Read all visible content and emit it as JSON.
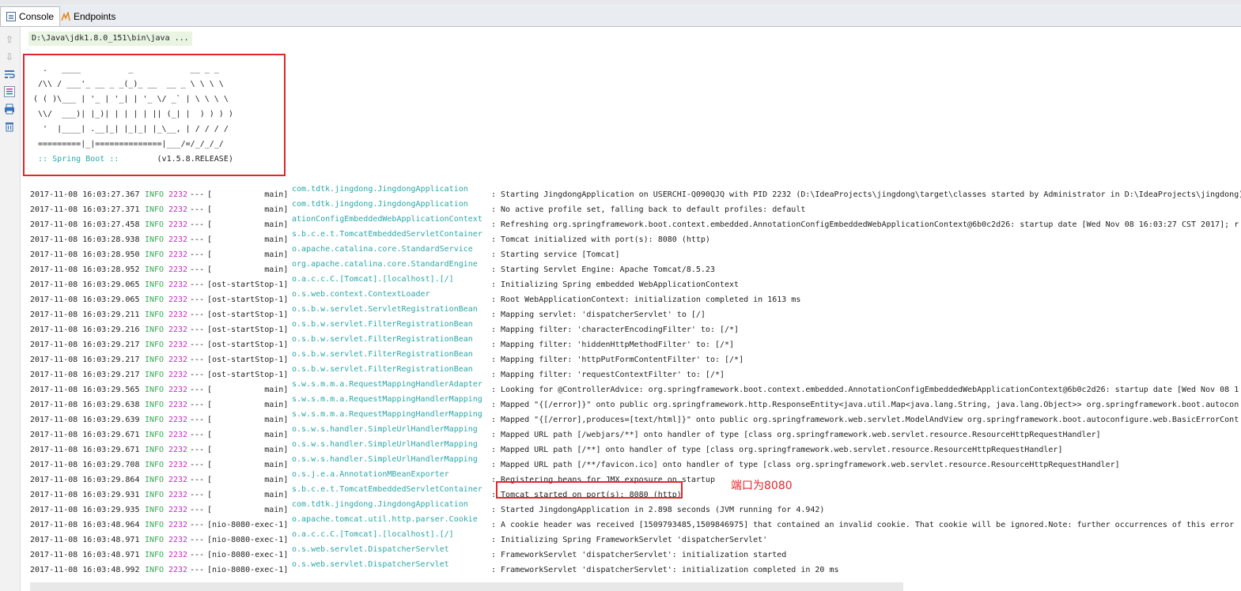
{
  "tabs": [
    {
      "label": "Console",
      "icon": "console-icon",
      "active": true
    },
    {
      "label": "Endpoints",
      "icon": "endpoints-icon",
      "active": false
    }
  ],
  "toolbar": {
    "icons": [
      "up-arrow-icon",
      "down-arrow-icon",
      "soft-wrap-icon",
      "scroll-to-end-icon",
      "print-icon",
      "trash-icon"
    ]
  },
  "console": {
    "command": "D:\\Java\\jdk1.8.0_151\\bin\\java ...",
    "banner_lines": [
      "  .   ____          _            __ _ _",
      " /\\\\ / ___'_ __ _ _(_)_ __  __ _ \\ \\ \\ \\",
      "( ( )\\___ | '_ | '_| | '_ \\/ _` | \\ \\ \\ \\",
      " \\\\/  ___)| |_)| | | | | || (_| |  ) ) ) )",
      "  '  |____| .__|_| |_|_| |_\\__, | / / / /",
      " =========|_|==============|___/=/_/_/_/"
    ],
    "spring_label": " :: Spring Boot :: ",
    "spring_version": "       (v1.5.8.RELEASE)",
    "logs": [
      {
        "ts": "2017-11-08 16:03:27.367",
        "level": "INFO",
        "pid": "2232",
        "sep": "---",
        "thread": "[           main]",
        "logger": "com.tdtk.jingdong.JingdongApplication",
        "msg": ": Starting JingdongApplication on USERCHI-Q090QJQ with PID 2232 (D:\\IdeaProjects\\jingdong\\target\\classes started by Administrator in D:\\IdeaProjects\\jingdong)"
      },
      {
        "ts": "2017-11-08 16:03:27.371",
        "level": "INFO",
        "pid": "2232",
        "sep": "---",
        "thread": "[           main]",
        "logger": "com.tdtk.jingdong.JingdongApplication",
        "msg": ": No active profile set, falling back to default profiles: default"
      },
      {
        "ts": "2017-11-08 16:03:27.458",
        "level": "INFO",
        "pid": "2232",
        "sep": "---",
        "thread": "[           main]",
        "logger": "ationConfigEmbeddedWebApplicationContext",
        "msg": ": Refreshing org.springframework.boot.context.embedded.AnnotationConfigEmbeddedWebApplicationContext@6b0c2d26: startup date [Wed Nov 08 16:03:27 CST 2017]; r"
      },
      {
        "ts": "2017-11-08 16:03:28.938",
        "level": "INFO",
        "pid": "2232",
        "sep": "---",
        "thread": "[           main]",
        "logger": "s.b.c.e.t.TomcatEmbeddedServletContainer",
        "msg": ": Tomcat initialized with port(s): 8080 (http)"
      },
      {
        "ts": "2017-11-08 16:03:28.950",
        "level": "INFO",
        "pid": "2232",
        "sep": "---",
        "thread": "[           main]",
        "logger": "o.apache.catalina.core.StandardService",
        "msg": ": Starting service [Tomcat]"
      },
      {
        "ts": "2017-11-08 16:03:28.952",
        "level": "INFO",
        "pid": "2232",
        "sep": "---",
        "thread": "[           main]",
        "logger": "org.apache.catalina.core.StandardEngine",
        "msg": ": Starting Servlet Engine: Apache Tomcat/8.5.23"
      },
      {
        "ts": "2017-11-08 16:03:29.065",
        "level": "INFO",
        "pid": "2232",
        "sep": "---",
        "thread": "[ost-startStop-1]",
        "logger": "o.a.c.c.C.[Tomcat].[localhost].[/]",
        "msg": ": Initializing Spring embedded WebApplicationContext"
      },
      {
        "ts": "2017-11-08 16:03:29.065",
        "level": "INFO",
        "pid": "2232",
        "sep": "---",
        "thread": "[ost-startStop-1]",
        "logger": "o.s.web.context.ContextLoader",
        "msg": ": Root WebApplicationContext: initialization completed in 1613 ms"
      },
      {
        "ts": "2017-11-08 16:03:29.211",
        "level": "INFO",
        "pid": "2232",
        "sep": "---",
        "thread": "[ost-startStop-1]",
        "logger": "o.s.b.w.servlet.ServletRegistrationBean",
        "msg": ": Mapping servlet: 'dispatcherServlet' to [/]"
      },
      {
        "ts": "2017-11-08 16:03:29.216",
        "level": "INFO",
        "pid": "2232",
        "sep": "---",
        "thread": "[ost-startStop-1]",
        "logger": "o.s.b.w.servlet.FilterRegistrationBean",
        "msg": ": Mapping filter: 'characterEncodingFilter' to: [/*]"
      },
      {
        "ts": "2017-11-08 16:03:29.217",
        "level": "INFO",
        "pid": "2232",
        "sep": "---",
        "thread": "[ost-startStop-1]",
        "logger": "o.s.b.w.servlet.FilterRegistrationBean",
        "msg": ": Mapping filter: 'hiddenHttpMethodFilter' to: [/*]"
      },
      {
        "ts": "2017-11-08 16:03:29.217",
        "level": "INFO",
        "pid": "2232",
        "sep": "---",
        "thread": "[ost-startStop-1]",
        "logger": "o.s.b.w.servlet.FilterRegistrationBean",
        "msg": ": Mapping filter: 'httpPutFormContentFilter' to: [/*]"
      },
      {
        "ts": "2017-11-08 16:03:29.217",
        "level": "INFO",
        "pid": "2232",
        "sep": "---",
        "thread": "[ost-startStop-1]",
        "logger": "o.s.b.w.servlet.FilterRegistrationBean",
        "msg": ": Mapping filter: 'requestContextFilter' to: [/*]"
      },
      {
        "ts": "2017-11-08 16:03:29.565",
        "level": "INFO",
        "pid": "2232",
        "sep": "---",
        "thread": "[           main]",
        "logger": "s.w.s.m.m.a.RequestMappingHandlerAdapter",
        "msg": ": Looking for @ControllerAdvice: org.springframework.boot.context.embedded.AnnotationConfigEmbeddedWebApplicationContext@6b0c2d26: startup date [Wed Nov 08 1"
      },
      {
        "ts": "2017-11-08 16:03:29.638",
        "level": "INFO",
        "pid": "2232",
        "sep": "---",
        "thread": "[           main]",
        "logger": "s.w.s.m.m.a.RequestMappingHandlerMapping",
        "msg": ": Mapped \"{[/error]}\" onto public org.springframework.http.ResponseEntity<java.util.Map<java.lang.String, java.lang.Object>> org.springframework.boot.autocon"
      },
      {
        "ts": "2017-11-08 16:03:29.639",
        "level": "INFO",
        "pid": "2232",
        "sep": "---",
        "thread": "[           main]",
        "logger": "s.w.s.m.m.a.RequestMappingHandlerMapping",
        "msg": ": Mapped \"{[/error],produces=[text/html]}\" onto public org.springframework.web.servlet.ModelAndView org.springframework.boot.autoconfigure.web.BasicErrorCont"
      },
      {
        "ts": "2017-11-08 16:03:29.671",
        "level": "INFO",
        "pid": "2232",
        "sep": "---",
        "thread": "[           main]",
        "logger": "o.s.w.s.handler.SimpleUrlHandlerMapping",
        "msg": ": Mapped URL path [/webjars/**] onto handler of type [class org.springframework.web.servlet.resource.ResourceHttpRequestHandler]"
      },
      {
        "ts": "2017-11-08 16:03:29.671",
        "level": "INFO",
        "pid": "2232",
        "sep": "---",
        "thread": "[           main]",
        "logger": "o.s.w.s.handler.SimpleUrlHandlerMapping",
        "msg": ": Mapped URL path [/**] onto handler of type [class org.springframework.web.servlet.resource.ResourceHttpRequestHandler]"
      },
      {
        "ts": "2017-11-08 16:03:29.708",
        "level": "INFO",
        "pid": "2232",
        "sep": "---",
        "thread": "[           main]",
        "logger": "o.s.w.s.handler.SimpleUrlHandlerMapping",
        "msg": ": Mapped URL path [/**/favicon.ico] onto handler of type [class org.springframework.web.servlet.resource.ResourceHttpRequestHandler]"
      },
      {
        "ts": "2017-11-08 16:03:29.864",
        "level": "INFO",
        "pid": "2232",
        "sep": "---",
        "thread": "[           main]",
        "logger": "o.s.j.e.a.AnnotationMBeanExporter",
        "msg": ": Registering beans for JMX exposure on startup"
      },
      {
        "ts": "2017-11-08 16:03:29.931",
        "level": "INFO",
        "pid": "2232",
        "sep": "---",
        "thread": "[           main]",
        "logger": "s.b.c.e.t.TomcatEmbeddedServletContainer",
        "msg": ": Tomcat started on port(s): 8080 (http)"
      },
      {
        "ts": "2017-11-08 16:03:29.935",
        "level": "INFO",
        "pid": "2232",
        "sep": "---",
        "thread": "[           main]",
        "logger": "com.tdtk.jingdong.JingdongApplication",
        "msg": ": Started JingdongApplication in 2.898 seconds (JVM running for 4.942)"
      },
      {
        "ts": "2017-11-08 16:03:48.964",
        "level": "INFO",
        "pid": "2232",
        "sep": "---",
        "thread": "[nio-8080-exec-1]",
        "logger": "o.apache.tomcat.util.http.parser.Cookie",
        "msg": ": A cookie header was received [1509793485,1509846975] that contained an invalid cookie. That cookie will be ignored.Note: further occurrences of this error"
      },
      {
        "ts": "2017-11-08 16:03:48.971",
        "level": "INFO",
        "pid": "2232",
        "sep": "---",
        "thread": "[nio-8080-exec-1]",
        "logger": "o.a.c.c.C.[Tomcat].[localhost].[/]",
        "msg": ": Initializing Spring FrameworkServlet 'dispatcherServlet'"
      },
      {
        "ts": "2017-11-08 16:03:48.971",
        "level": "INFO",
        "pid": "2232",
        "sep": "---",
        "thread": "[nio-8080-exec-1]",
        "logger": "o.s.web.servlet.DispatcherServlet",
        "msg": ": FrameworkServlet 'dispatcherServlet': initialization started"
      },
      {
        "ts": "2017-11-08 16:03:48.992",
        "level": "INFO",
        "pid": "2232",
        "sep": "---",
        "thread": "[nio-8080-exec-1]",
        "logger": "o.s.web.servlet.DispatcherServlet",
        "msg": ": FrameworkServlet 'dispatcherServlet': initialization completed in 20 ms"
      }
    ]
  },
  "annotation": {
    "text": "端口为8080",
    "color": "#e3262b"
  },
  "colors": {
    "info": "#35a853",
    "pid": "#c428c4",
    "logger": "#2aa7a7",
    "highlight_box": "#e3262b"
  }
}
